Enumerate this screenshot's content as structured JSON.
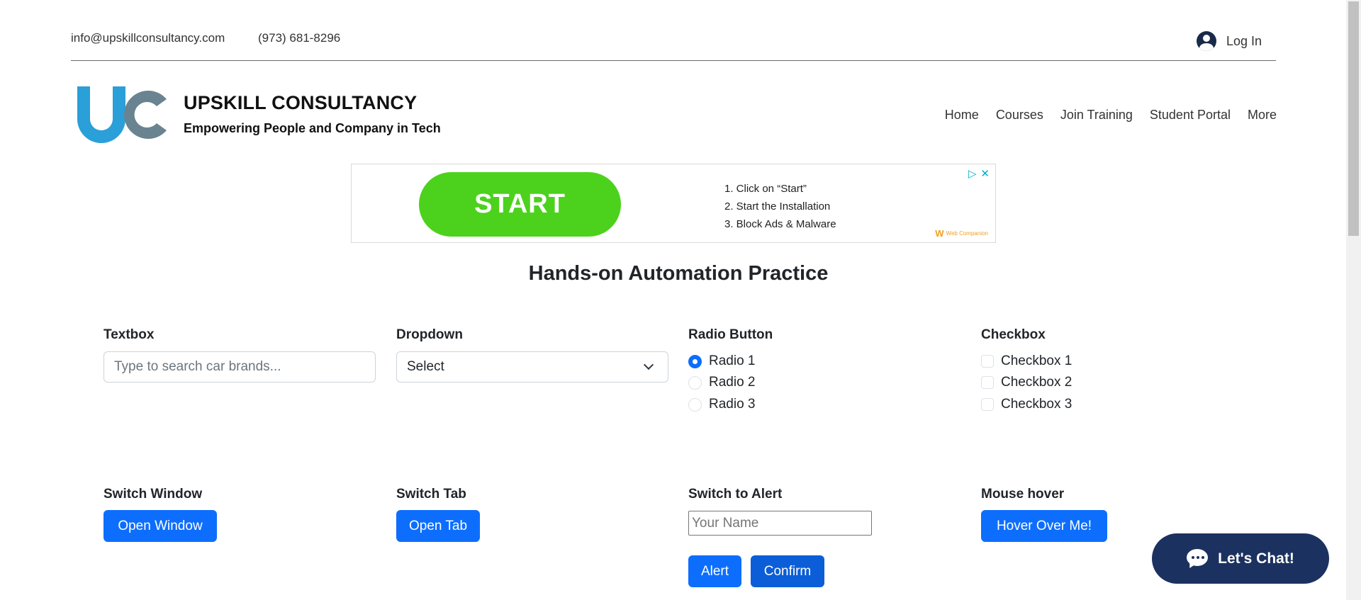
{
  "topbar": {
    "email": "info@upskillconsultancy.com",
    "phone": "(973) 681-8296",
    "login_label": "Log In"
  },
  "brand": {
    "name": "UPSKILL CONSULTANCY",
    "tagline": "Empowering People and Company in Tech",
    "logo_colors": {
      "u": "#2a9fd8",
      "c": "#6a8390"
    }
  },
  "nav": [
    "Home",
    "Courses",
    "Join Training",
    "Student Portal",
    "More"
  ],
  "ad": {
    "button": "START",
    "steps": [
      "1. Click on “Start”",
      "2. Start the Installation",
      "3. Block Ads & Malware"
    ],
    "badge": "Web Companion",
    "colors": {
      "button": "#4cd21c",
      "icons": "#00aecd"
    }
  },
  "main": {
    "title": "Hands-on Automation Practice",
    "textbox": {
      "label": "Textbox",
      "placeholder": "Type to search car brands..."
    },
    "dropdown": {
      "label": "Dropdown",
      "value": "Select"
    },
    "radio": {
      "label": "Radio Button",
      "options": [
        "Radio 1",
        "Radio 2",
        "Radio 3"
      ],
      "selected": "Radio 1"
    },
    "checkbox": {
      "label": "Checkbox",
      "options": [
        "Checkbox 1",
        "Checkbox 2",
        "Checkbox 3"
      ]
    },
    "switch_window": {
      "label": "Switch Window",
      "button": "Open Window"
    },
    "switch_tab": {
      "label": "Switch Tab",
      "button": "Open Tab"
    },
    "switch_alert": {
      "label": "Switch to Alert",
      "placeholder": "Your Name",
      "alert_button": "Alert",
      "confirm_button": "Confirm"
    },
    "mouse_hover": {
      "label": "Mouse hover",
      "button": "Hover Over Me!"
    }
  },
  "chat": {
    "label": "Let's Chat!"
  },
  "colors": {
    "primary": "#0d6efd",
    "chat_bg": "#1b3160"
  }
}
